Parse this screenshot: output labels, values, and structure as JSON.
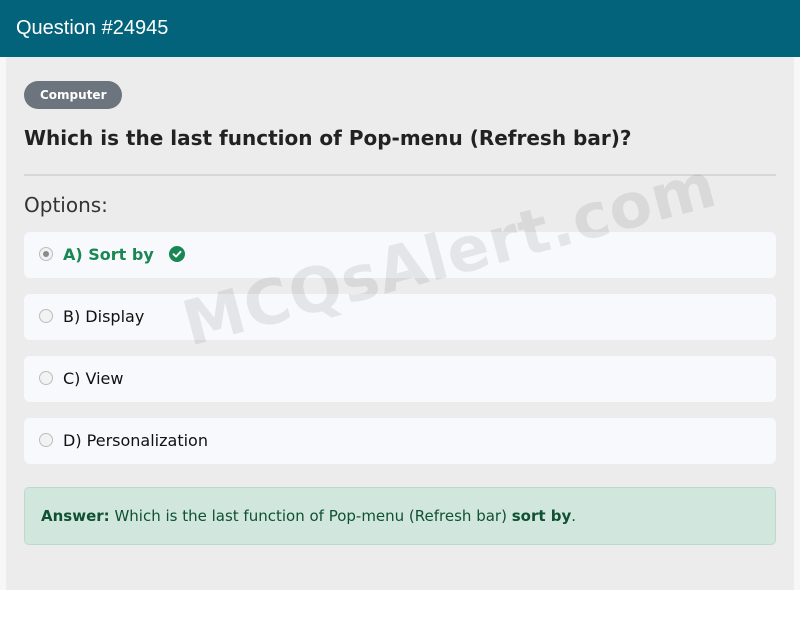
{
  "header": {
    "title": "Question #24945"
  },
  "category_badge": "Computer",
  "question": "Which is the last function of Pop-menu (Refresh bar)?",
  "options_label": "Options:",
  "options": [
    {
      "label": "A) Sort by",
      "correct": true,
      "selected": true
    },
    {
      "label": "B) Display",
      "correct": false,
      "selected": false
    },
    {
      "label": "C) View",
      "correct": false,
      "selected": false
    },
    {
      "label": "D) Personalization",
      "correct": false,
      "selected": false
    }
  ],
  "answer": {
    "prefix": "Answer:",
    "text": "Which is the last function of Pop-menu (Refresh bar)",
    "value": "sort by",
    "suffix": "."
  },
  "watermark": "MCQsAlert.com",
  "colors": {
    "header_bg": "#03637a",
    "correct": "#198754",
    "answer_bg": "#d1e7dd",
    "badge_bg": "#6c757d"
  },
  "icons": {
    "correct_indicator": "check-circle-icon"
  }
}
